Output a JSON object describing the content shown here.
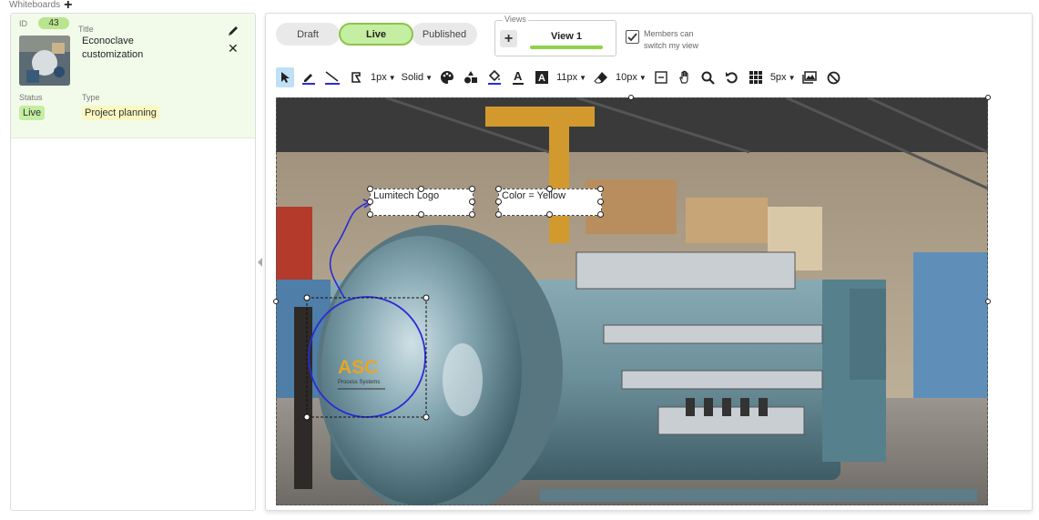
{
  "page": {
    "section_title": "Whiteboards"
  },
  "card": {
    "id_label": "ID",
    "id_value": "43",
    "title_label": "Title",
    "title_value": "Econoclave customization",
    "status_label": "Status",
    "status_value": "Live",
    "type_label": "Type",
    "type_value": "Project planning"
  },
  "tabs": [
    {
      "label": "Draft"
    },
    {
      "label": "Live"
    },
    {
      "label": "Published"
    }
  ],
  "views": {
    "legend": "Views",
    "add_label": "+",
    "items": [
      {
        "label": "View 1"
      }
    ]
  },
  "members": {
    "label": "Members can switch my view",
    "checked": true
  },
  "toolbar": {
    "stroke_width": "1px",
    "stroke_style": "Solid",
    "font_size": "11px",
    "eraser_size": "10px",
    "grid_size": "5px"
  },
  "canvas": {
    "annotations": [
      {
        "text": "Lumitech Logo"
      },
      {
        "text": "Color = Yellow"
      }
    ],
    "logo_text": "ASC",
    "logo_subtext": "Process Systems"
  },
  "colors": {
    "live_green": "#c4eea1",
    "accent_blue": "#2b2bd6",
    "card_bg": "#f2fbe9"
  }
}
